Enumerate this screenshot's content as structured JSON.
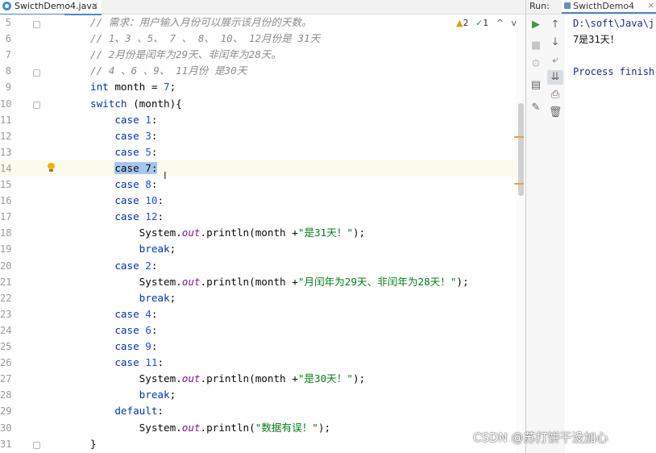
{
  "editor_tab": {
    "filename": "SwicthDemo4.java",
    "close": "×"
  },
  "inspections": {
    "warnings": "2",
    "ok": "1",
    "up": "^",
    "down": "v"
  },
  "lines": [
    {
      "num": "5",
      "tokens": [
        {
          "t": "cm",
          "v": "// 需求：用户输入月份可以展示该月份的天数。"
        }
      ]
    },
    {
      "num": "6",
      "tokens": [
        {
          "t": "cm",
          "v": "// 1、3 、5、 7 、 8、 10、 12月份是 31天"
        }
      ]
    },
    {
      "num": "7",
      "tokens": [
        {
          "t": "cm",
          "v": "// 2月份是闰年为29天、非闰年为28天。"
        }
      ]
    },
    {
      "num": "8",
      "tokens": [
        {
          "t": "cm",
          "v": "// 4 、6 、9、 11月份 是30天"
        }
      ]
    },
    {
      "num": "9",
      "tokens": [
        {
          "t": "kw",
          "v": "int"
        },
        {
          "t": "p",
          "v": " month = "
        },
        {
          "t": "num",
          "v": "7"
        },
        {
          "t": "p",
          "v": ";"
        }
      ]
    },
    {
      "num": "10",
      "tokens": [
        {
          "t": "kw",
          "v": "switch"
        },
        {
          "t": "p",
          "v": " (month){"
        }
      ]
    },
    {
      "num": "11",
      "tokens": [
        {
          "t": "p",
          "v": "    "
        },
        {
          "t": "kw",
          "v": "case"
        },
        {
          "t": "p",
          "v": " "
        },
        {
          "t": "num",
          "v": "1"
        },
        {
          "t": "p",
          "v": ":"
        }
      ]
    },
    {
      "num": "12",
      "tokens": [
        {
          "t": "p",
          "v": "    "
        },
        {
          "t": "kw",
          "v": "case"
        },
        {
          "t": "p",
          "v": " "
        },
        {
          "t": "num",
          "v": "3"
        },
        {
          "t": "p",
          "v": ":"
        }
      ]
    },
    {
      "num": "13",
      "tokens": [
        {
          "t": "p",
          "v": "    "
        },
        {
          "t": "kw",
          "v": "case"
        },
        {
          "t": "p",
          "v": " "
        },
        {
          "t": "num",
          "v": "5"
        },
        {
          "t": "p",
          "v": ":"
        }
      ]
    },
    {
      "num": "14",
      "current": true,
      "tokens": [
        {
          "t": "p",
          "v": "    "
        },
        {
          "t": "sel",
          "v": "case 7:"
        }
      ]
    },
    {
      "num": "15",
      "tokens": [
        {
          "t": "p",
          "v": "    "
        },
        {
          "t": "kw",
          "v": "case"
        },
        {
          "t": "p",
          "v": " "
        },
        {
          "t": "num",
          "v": "8"
        },
        {
          "t": "p",
          "v": ":"
        }
      ]
    },
    {
      "num": "16",
      "tokens": [
        {
          "t": "p",
          "v": "    "
        },
        {
          "t": "kw",
          "v": "case"
        },
        {
          "t": "p",
          "v": " "
        },
        {
          "t": "num",
          "v": "10"
        },
        {
          "t": "p",
          "v": ":"
        }
      ]
    },
    {
      "num": "17",
      "tokens": [
        {
          "t": "p",
          "v": "    "
        },
        {
          "t": "kw",
          "v": "case"
        },
        {
          "t": "p",
          "v": " "
        },
        {
          "t": "num",
          "v": "12"
        },
        {
          "t": "p",
          "v": ":"
        }
      ]
    },
    {
      "num": "18",
      "tokens": [
        {
          "t": "p",
          "v": "        System."
        },
        {
          "t": "fld",
          "v": "out"
        },
        {
          "t": "p",
          "v": ".println(month +"
        },
        {
          "t": "str",
          "v": "\"是31天！\""
        },
        {
          "t": "p",
          "v": ");"
        }
      ]
    },
    {
      "num": "19",
      "tokens": [
        {
          "t": "p",
          "v": "        "
        },
        {
          "t": "kw",
          "v": "break"
        },
        {
          "t": "p",
          "v": ";"
        }
      ]
    },
    {
      "num": "20",
      "tokens": [
        {
          "t": "p",
          "v": "    "
        },
        {
          "t": "kw",
          "v": "case"
        },
        {
          "t": "p",
          "v": " "
        },
        {
          "t": "num",
          "v": "2"
        },
        {
          "t": "p",
          "v": ":"
        }
      ]
    },
    {
      "num": "21",
      "tokens": [
        {
          "t": "p",
          "v": "        System."
        },
        {
          "t": "fld",
          "v": "out"
        },
        {
          "t": "p",
          "v": ".println(month +"
        },
        {
          "t": "str",
          "v": "\"月闰年为29天、非闰年为28天！\""
        },
        {
          "t": "p",
          "v": ");"
        }
      ]
    },
    {
      "num": "22",
      "tokens": [
        {
          "t": "p",
          "v": "        "
        },
        {
          "t": "kw",
          "v": "break"
        },
        {
          "t": "p",
          "v": ";"
        }
      ]
    },
    {
      "num": "23",
      "tokens": [
        {
          "t": "p",
          "v": "    "
        },
        {
          "t": "kw",
          "v": "case"
        },
        {
          "t": "p",
          "v": " "
        },
        {
          "t": "num",
          "v": "4"
        },
        {
          "t": "p",
          "v": ":"
        }
      ]
    },
    {
      "num": "24",
      "tokens": [
        {
          "t": "p",
          "v": "    "
        },
        {
          "t": "kw",
          "v": "case"
        },
        {
          "t": "p",
          "v": " "
        },
        {
          "t": "num",
          "v": "6"
        },
        {
          "t": "p",
          "v": ":"
        }
      ]
    },
    {
      "num": "25",
      "tokens": [
        {
          "t": "p",
          "v": "    "
        },
        {
          "t": "kw",
          "v": "case"
        },
        {
          "t": "p",
          "v": " "
        },
        {
          "t": "num",
          "v": "9"
        },
        {
          "t": "p",
          "v": ":"
        }
      ]
    },
    {
      "num": "26",
      "tokens": [
        {
          "t": "p",
          "v": "    "
        },
        {
          "t": "kw",
          "v": "case"
        },
        {
          "t": "p",
          "v": " "
        },
        {
          "t": "num",
          "v": "11"
        },
        {
          "t": "p",
          "v": ":"
        }
      ]
    },
    {
      "num": "27",
      "tokens": [
        {
          "t": "p",
          "v": "        System."
        },
        {
          "t": "fld",
          "v": "out"
        },
        {
          "t": "p",
          "v": ".println(month +"
        },
        {
          "t": "str",
          "v": "\"是30天！\""
        },
        {
          "t": "p",
          "v": ");"
        }
      ]
    },
    {
      "num": "28",
      "tokens": [
        {
          "t": "p",
          "v": "        "
        },
        {
          "t": "kw",
          "v": "break"
        },
        {
          "t": "p",
          "v": ";"
        }
      ]
    },
    {
      "num": "29",
      "tokens": [
        {
          "t": "p",
          "v": "    "
        },
        {
          "t": "kw",
          "v": "default"
        },
        {
          "t": "p",
          "v": ":"
        }
      ]
    },
    {
      "num": "30",
      "tokens": [
        {
          "t": "p",
          "v": "        System."
        },
        {
          "t": "fld",
          "v": "out"
        },
        {
          "t": "p",
          "v": ".println("
        },
        {
          "t": "str",
          "v": "\"数据有误！\""
        },
        {
          "t": "p",
          "v": ");"
        }
      ]
    },
    {
      "num": "31",
      "tokens": [
        {
          "t": "p",
          "v": "}"
        }
      ]
    }
  ],
  "run": {
    "label": "Run:",
    "tab": "SwicthDemo4",
    "close": "×",
    "console": [
      "D:\\soft\\Java\\j",
      "7是31天！",
      "",
      "Process finish"
    ]
  },
  "toolbar_icons": [
    "run-icon",
    "rerun-up-icon",
    "stop-icon",
    "rerun-down-icon",
    "camera-icon",
    "soft-wrap-icon",
    "layout-icon",
    "scroll-to-end-icon",
    "pin-icon",
    "print-icon",
    "trash-icon"
  ],
  "colors": {
    "keyword": "#0033b3",
    "number": "#1750eb",
    "string": "#067d17",
    "comment": "#8c8c8c",
    "selection": "#a6c6f2",
    "current_line": "#fcfaed"
  },
  "watermark": "CSDN @苏打饼干没加心"
}
